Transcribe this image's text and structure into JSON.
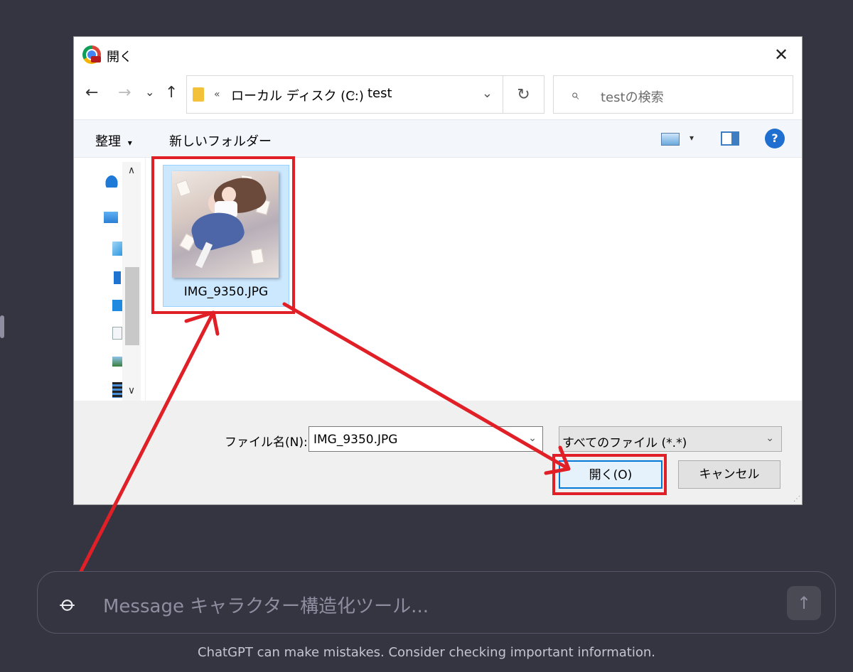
{
  "dialog": {
    "title": "開く",
    "close_label": "✕",
    "nav": {
      "back": "←",
      "forward": "→",
      "recent": "⌄",
      "up": "↑"
    },
    "address": {
      "overflow": "«",
      "crumbs": [
        "ローカル ディスク (C:)",
        "test"
      ],
      "separator": "›",
      "dropdown": "⌄",
      "refresh": "↻"
    },
    "search": {
      "icon": "search-icon",
      "placeholder": "testの検索"
    },
    "toolbar": {
      "organize": "整理",
      "organize_caret": "▾",
      "new_folder": "新しいフォルダー",
      "view_caret": "▾",
      "help": "?"
    },
    "nav_pane": {
      "icons": [
        "onedrive-icon",
        "this-pc-icon",
        "3d-objects-icon",
        "downloads-icon",
        "desktop-icon",
        "documents-icon",
        "pictures-icon",
        "videos-icon"
      ],
      "scroll_up": "∧",
      "scroll_down": "∨"
    },
    "files": [
      {
        "name": "IMG_9350.JPG",
        "selected": true
      }
    ],
    "footer": {
      "filename_label": "ファイル名(N):",
      "filename_value": "IMG_9350.JPG",
      "filetype_value": "すべてのファイル (*.*)",
      "open_button": "開く(O)",
      "cancel_button": "キャンセル",
      "dd": "⌄"
    }
  },
  "composer": {
    "placeholder": "Message キャラクター構造化ツール...",
    "send": "↑"
  },
  "disclaimer": "ChatGPT can make mistakes. Consider checking important information.",
  "colors": {
    "annotation_red": "#e01f26",
    "app_bg": "#343541",
    "accent_blue": "#0078d7"
  }
}
